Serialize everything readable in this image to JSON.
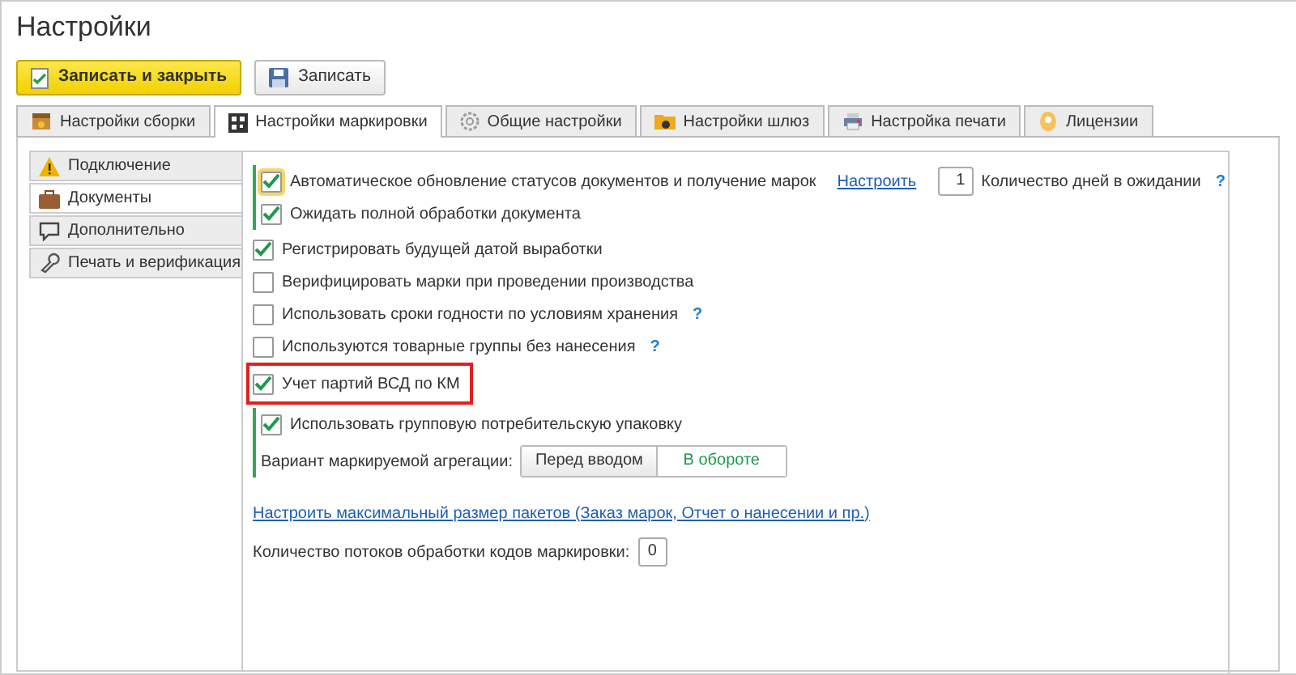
{
  "window": {
    "title": "Настройки"
  },
  "toolbar": [
    {
      "label": "Записать и закрыть",
      "kind": "primary"
    },
    {
      "label": "Записать",
      "kind": "save"
    }
  ],
  "tabs": [
    {
      "label": "Настройки сборки",
      "selected": false
    },
    {
      "label": "Настройки маркировки",
      "selected": true
    },
    {
      "label": "Общие настройки",
      "selected": false
    },
    {
      "label": "Настройки шлюз",
      "selected": false
    },
    {
      "label": "Настройка печати",
      "selected": false
    },
    {
      "label": "Лицензии",
      "selected": false
    }
  ],
  "sidebar": {
    "items": [
      {
        "label": "Подключение",
        "selected": false
      },
      {
        "label": "Документы",
        "selected": true
      },
      {
        "label": "Дополнительно",
        "selected": false
      },
      {
        "label": "Печать и верификация",
        "selected": false
      }
    ]
  },
  "rows": [
    {
      "kind": "group",
      "children": [
        {
          "kind": "checkbox",
          "label": "Автоматическое обновление статусов документов и получение марок",
          "checked": true,
          "focused": true,
          "link": "Настроить",
          "count": "1",
          "count_label": "Количество дней в ожидании",
          "help": "?"
        },
        {
          "kind": "checkbox",
          "label": "Ожидать полной обработки документа",
          "checked": true
        }
      ]
    },
    {
      "kind": "checkbox",
      "label": "Регистрировать будущей датой выработки",
      "checked": true
    },
    {
      "kind": "checkbox",
      "label": "Верифицировать марки при проведении производства",
      "checked": false
    },
    {
      "kind": "checkbox",
      "label": "Использовать сроки годности по условиям хранения",
      "checked": false,
      "help": "?"
    },
    {
      "kind": "checkbox",
      "label": "Используются товарные группы без нанесения",
      "checked": false,
      "help": "?"
    },
    {
      "kind": "checkbox",
      "label": "Учет партий ВСД по КМ",
      "checked": true,
      "highlighted": true
    },
    {
      "kind": "group",
      "children": [
        {
          "kind": "checkbox",
          "label": "Использовать групповую потребительскую упаковку",
          "checked": true
        },
        {
          "kind": "choice",
          "label": "Вариант маркируемой агрегации:",
          "options": [
            {
              "label": "Перед вводом",
              "selected": false
            },
            {
              "label": "В обороте",
              "selected": true
            }
          ]
        }
      ]
    },
    {
      "kind": "link",
      "label": "Настроить максимальный размер пакетов (Заказ марок, Отчет о нанесении и пр.)"
    },
    {
      "kind": "number",
      "label": "Количество потоков обработки кодов маркировки:",
      "value": "0"
    }
  ]
}
